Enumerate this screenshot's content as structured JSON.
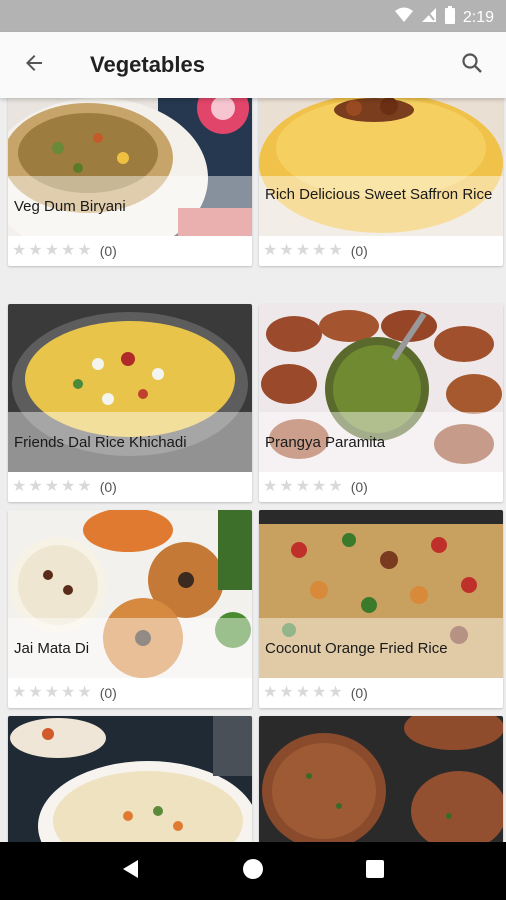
{
  "status_bar": {
    "time": "2:19"
  },
  "app_bar": {
    "title": "Vegetables"
  },
  "recipes": [
    {
      "title": "Veg Dum Biryani",
      "rating_count": "(0)"
    },
    {
      "title": "Rich Delicious Sweet Saffron Rice",
      "rating_count": "(0)"
    },
    {
      "title": "Friends Dal Rice Khichadi",
      "rating_count": "(0)"
    },
    {
      "title": "Prangya Paramita",
      "rating_count": "(0)"
    },
    {
      "title": "Jai Mata Di",
      "rating_count": "(0)"
    },
    {
      "title": "Coconut Orange Fried Rice",
      "rating_count": "(0)"
    }
  ],
  "icons": {
    "back": "arrow-back-icon",
    "search": "search-icon",
    "star": "star-icon",
    "nav_back": "triangle-back-icon",
    "nav_home": "circle-home-icon",
    "nav_recents": "square-recents-icon"
  },
  "colors": {
    "star_empty": "#d9d9d9",
    "app_bar_bg": "#fafafa",
    "status_bar_bg": "#b3b3b3"
  }
}
